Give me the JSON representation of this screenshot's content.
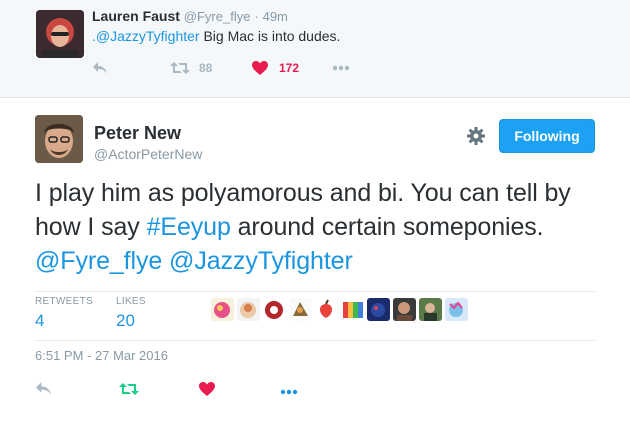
{
  "parent_tweet": {
    "author_name": "Lauren Faust",
    "author_handle": "@Fyre_flye",
    "separator": "·",
    "time": "49m",
    "mention": ".@JazzyTyfighter",
    "text_rest": " Big Mac is into dudes.",
    "retweet_count": "88",
    "like_count": "172",
    "icons": [
      "reply-icon",
      "retweet-icon",
      "heart-icon",
      "more-icon"
    ]
  },
  "tweet": {
    "author_name": "Peter New",
    "author_handle": "@ActorPeterNew",
    "follow_label": "Following",
    "text_part1": "I play him as polyamorous and bi. You can tell by how I say ",
    "hashtag": "#Eeyup",
    "text_part2": " around certain someponies. ",
    "mention1": "@Fyre_flye",
    "text_space": " ",
    "mention2": "@JazzyTyfighter",
    "retweets_label": "RETWEETS",
    "retweets_count": "4",
    "likes_label": "LIKES",
    "likes_count": "20",
    "timestamp": "6:51 PM - 27 Mar 2016",
    "icons": [
      "gear-icon",
      "reply-icon",
      "retweet-icon",
      "heart-icon",
      "more-icon"
    ]
  },
  "colors": {
    "accent": "#1da1f2",
    "link": "#1b95e0",
    "retweeted": "#19cf86",
    "liked": "#e81c4f",
    "muted": "#8899a6"
  }
}
